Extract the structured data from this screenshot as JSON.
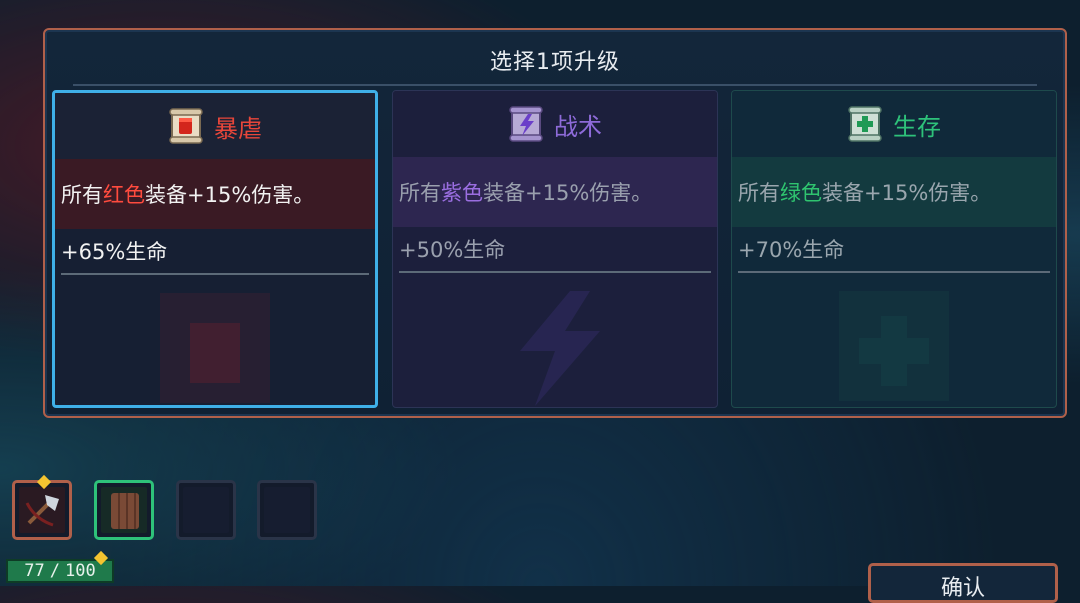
{
  "dialog": {
    "title": "选择1项升级"
  },
  "cards": [
    {
      "name": "暴虐",
      "icon": "red-fist-scroll-icon",
      "desc_prefix": "所有",
      "desc_color_word": "红色",
      "desc_suffix": "装备+15%伤害。",
      "stat": "+65%生命",
      "accent": "#e8463a",
      "selected": true
    },
    {
      "name": "战术",
      "icon": "purple-lightning-scroll-icon",
      "desc_prefix": "所有",
      "desc_color_word": "紫色",
      "desc_suffix": "装备+15%伤害。",
      "stat": "+50%生命",
      "accent": "#8e6bd9",
      "selected": false
    },
    {
      "name": "生存",
      "icon": "green-cross-scroll-icon",
      "desc_prefix": "所有",
      "desc_color_word": "绿色",
      "desc_suffix": "装备+15%伤害。",
      "stat": "+70%生命",
      "accent": "#2ec27a",
      "selected": false
    }
  ],
  "inventory": {
    "slots": [
      {
        "icon": "axe-weapon-icon",
        "border": "#b0604a",
        "has_upgrade_star": true
      },
      {
        "icon": "wooden-shield-icon",
        "border": "#2ec27a",
        "has_upgrade_star": false
      },
      {
        "icon": "empty-slot-icon",
        "border": "#2a3448",
        "has_upgrade_star": false
      },
      {
        "icon": "empty-slot-icon",
        "border": "#2a3448",
        "has_upgrade_star": false
      }
    ]
  },
  "health": {
    "current": "77",
    "separator": "/",
    "max": "100",
    "has_upgrade_star": true
  },
  "confirm_button": {
    "label": "确认"
  }
}
